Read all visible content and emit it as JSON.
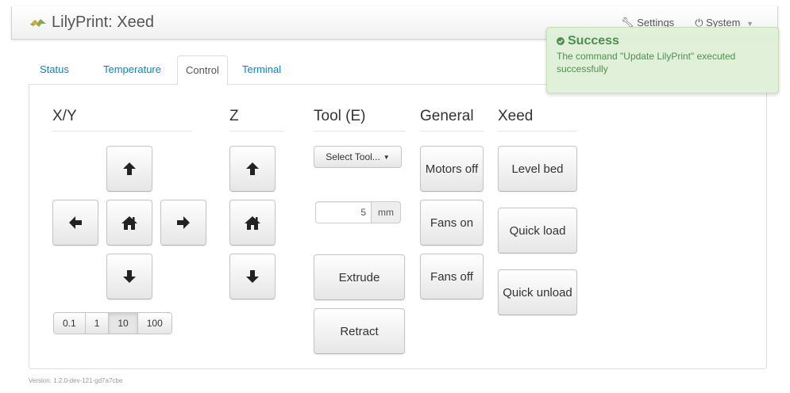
{
  "navbar": {
    "brand": "LilyPrint: Xeed",
    "settings_label": "Settings",
    "system_label": "System"
  },
  "tabs": [
    {
      "label": "Status"
    },
    {
      "label": "Temperature"
    },
    {
      "label": "Control",
      "active": true
    },
    {
      "label": "Terminal"
    }
  ],
  "control": {
    "xy": {
      "title": "X/Y",
      "step_sizes": [
        "0.1",
        "1",
        "10",
        "100"
      ],
      "selected_step": "10"
    },
    "z": {
      "title": "Z"
    },
    "tool": {
      "title": "Tool (E)",
      "select_label": "Select Tool...",
      "amount_value": "5",
      "amount_unit": "mm",
      "extrude_label": "Extrude",
      "retract_label": "Retract"
    },
    "general": {
      "title": "General",
      "motors_off_label": "Motors off",
      "fans_on_label": "Fans on",
      "fans_off_label": "Fans off"
    },
    "xeed": {
      "title": "Xeed",
      "level_bed_label": "Level bed",
      "quick_load_label": "Quick load",
      "quick_unload_label": "Quick unload"
    }
  },
  "notification": {
    "title": "Success",
    "message": "The command \"Update LilyPrint\" executed successfully"
  },
  "footer": {
    "version": "Version: 1.2.0-dev-121-gd7a7cbe"
  },
  "colors": {
    "link": "#0088cc",
    "success_bg": "#dff0d8",
    "success_text": "#468847"
  }
}
